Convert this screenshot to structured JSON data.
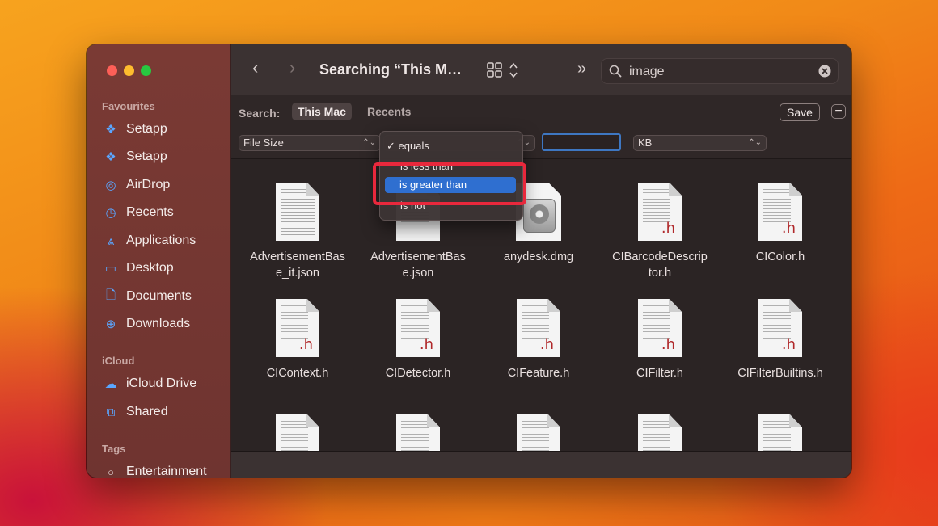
{
  "window": {
    "title": "Searching “This M…"
  },
  "sidebar": {
    "sections": [
      "Favourites",
      "iCloud",
      "Tags"
    ],
    "favourites": [
      {
        "label": "Setapp",
        "icon": "setapp-icon"
      },
      {
        "label": "Setapp",
        "icon": "setapp-icon"
      },
      {
        "label": "AirDrop",
        "icon": "airdrop-icon"
      },
      {
        "label": "Recents",
        "icon": "clock-icon"
      },
      {
        "label": "Applications",
        "icon": "applications-icon"
      },
      {
        "label": "Desktop",
        "icon": "desktop-icon"
      },
      {
        "label": "Documents",
        "icon": "document-icon"
      },
      {
        "label": "Downloads",
        "icon": "download-icon"
      }
    ],
    "icloud": [
      {
        "label": "iCloud Drive",
        "icon": "cloud-icon"
      },
      {
        "label": "Shared",
        "icon": "shared-folder-icon"
      }
    ],
    "tags": [
      {
        "label": "Entertainment",
        "icon": "tag-circle-icon"
      }
    ]
  },
  "toolbar": {
    "search_value": "image"
  },
  "search_scope": {
    "label": "Search:",
    "active": "This Mac",
    "inactive": "Recents",
    "save_label": "Save"
  },
  "criteria": {
    "attribute": "File Size",
    "unit": "KB",
    "value": ""
  },
  "dropdown": {
    "items": [
      "equals",
      "is less than",
      "is greater than",
      "is not"
    ],
    "checked_index": 0,
    "selected_index": 2
  },
  "files": [
    {
      "name1": "AdvertisementBas",
      "name2": "e_it.json",
      "kind": "json"
    },
    {
      "name1": "AdvertisementBas",
      "name2": "e.json",
      "kind": "json"
    },
    {
      "name1": "anydesk.dmg",
      "name2": "",
      "kind": "dmg"
    },
    {
      "name1": "CIBarcodeDescrip",
      "name2": "tor.h",
      "kind": "h"
    },
    {
      "name1": "CIColor.h",
      "name2": "",
      "kind": "h"
    },
    {
      "name1": "CIContext.h",
      "name2": "",
      "kind": "h"
    },
    {
      "name1": "CIDetector.h",
      "name2": "",
      "kind": "h"
    },
    {
      "name1": "CIFeature.h",
      "name2": "",
      "kind": "h"
    },
    {
      "name1": "CIFilter.h",
      "name2": "",
      "kind": "h"
    },
    {
      "name1": "CIFilterBuiltins.h",
      "name2": "",
      "kind": "h"
    }
  ],
  "accent": "#2f6fd0",
  "highlight_color": "#e8283c"
}
